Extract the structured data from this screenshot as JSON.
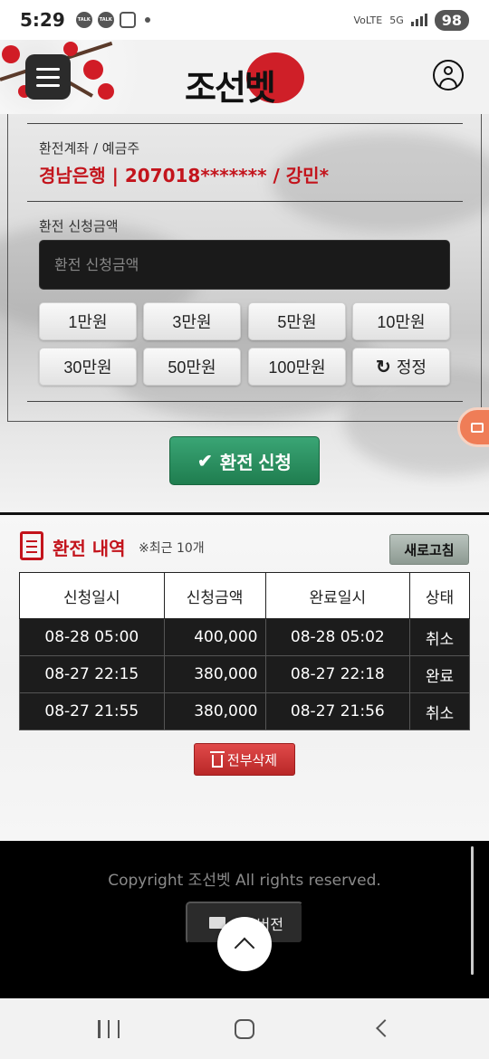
{
  "status_bar": {
    "time": "5:29",
    "network": "5G",
    "carrier": "VoLTE",
    "battery": "98"
  },
  "header": {
    "logo_text": "조선벳"
  },
  "exchange_form": {
    "account_label": "환전계좌 / 예금주",
    "account_value": "경남은행 | 207018******* / 강민*",
    "amount_label": "환전 신청금액",
    "amount_placeholder": "환전 신청금액",
    "amount_buttons": [
      "1만원",
      "3만원",
      "5만원",
      "10만원",
      "30만원",
      "50만원",
      "100만원"
    ],
    "reset_label": "정정",
    "submit_label": "환전 신청"
  },
  "history": {
    "title": "환전 내역",
    "note": "※최근 10개",
    "refresh_label": "새로고침",
    "columns": [
      "신청일시",
      "신청금액",
      "완료일시",
      "상태"
    ],
    "rows": [
      [
        "08-28 05:00",
        "400,000",
        "08-28 05:02",
        "취소"
      ],
      [
        "08-27 22:15",
        "380,000",
        "08-27 22:18",
        "완료"
      ],
      [
        "08-27 21:55",
        "380,000",
        "08-27 21:56",
        "취소"
      ]
    ],
    "delete_all_label": "전부삭제"
  },
  "footer": {
    "copyright": "Copyright 조선벳 All rights reserved.",
    "pc_version_label": "PC버전"
  },
  "colors": {
    "accent_red": "#c3141c",
    "submit_green": "#2a9160",
    "footer_bg": "#000000"
  }
}
